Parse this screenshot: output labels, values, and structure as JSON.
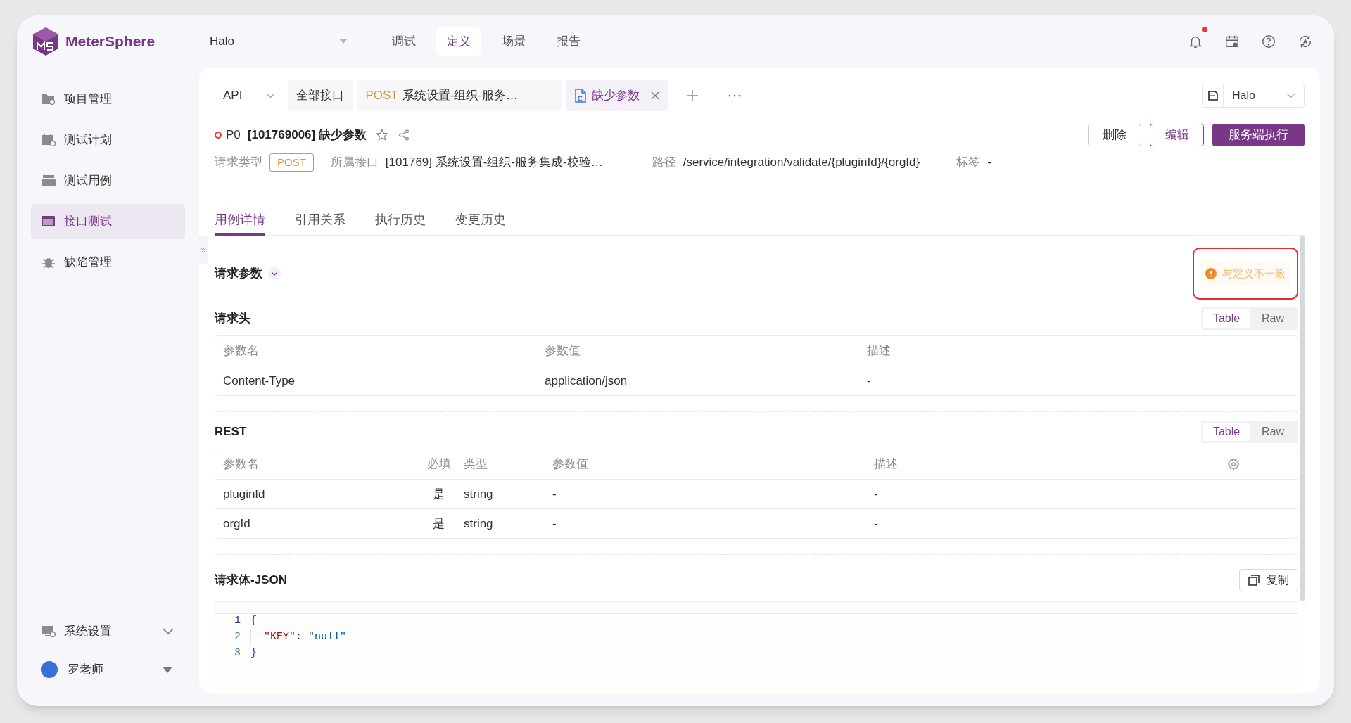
{
  "app": {
    "logo_text": "MeterSphere",
    "project": "Halo"
  },
  "top_nav": [
    {
      "label": "调试",
      "selected": false
    },
    {
      "label": "定义",
      "selected": true
    },
    {
      "label": "场景",
      "selected": false
    },
    {
      "label": "报告",
      "selected": false
    }
  ],
  "notifications": {
    "unread": true
  },
  "sidebar": {
    "items": [
      {
        "label": "项目管理",
        "kind": "folder",
        "selected": false
      },
      {
        "label": "测试计划",
        "kind": "plan",
        "selected": false
      },
      {
        "label": "测试用例",
        "kind": "case",
        "selected": false
      },
      {
        "label": "接口测试",
        "kind": "api",
        "selected": true
      },
      {
        "label": "缺陷管理",
        "kind": "bug",
        "selected": false
      }
    ],
    "settings": {
      "label": "系统设置"
    },
    "user": {
      "name": "罗老师"
    }
  },
  "tab_strip": {
    "module": "API",
    "tabs": [
      {
        "kind": "plain",
        "label": "全部接口",
        "selected": false
      },
      {
        "kind": "api",
        "method": "POST",
        "label": "系统设置-组织-服务…",
        "selected": false
      },
      {
        "kind": "case",
        "label": "缺少参数",
        "selected": true
      }
    ],
    "environment": "Halo"
  },
  "case": {
    "priority": "P0",
    "title": "[101769006] 缺少参数"
  },
  "actions": [
    {
      "label": "删除",
      "kind": "default"
    },
    {
      "label": "编辑",
      "kind": "outline"
    },
    {
      "label": "服务端执行",
      "kind": "primary"
    }
  ],
  "info": [
    {
      "label": "请求类型",
      "value": "POST",
      "kind": "badge"
    },
    {
      "label": "所属接口",
      "value": "[101769] 系统设置-组织-服务集成-校验…",
      "kind": "text"
    },
    {
      "label": "路径",
      "value": "/service/integration/validate/{pluginId}/{orgId}",
      "kind": "text"
    },
    {
      "label": "标签",
      "value": "-",
      "kind": "text"
    }
  ],
  "detail_tabs": [
    {
      "label": "用例详情",
      "selected": true
    },
    {
      "label": "引用关系",
      "selected": false
    },
    {
      "label": "执行历史",
      "selected": false
    },
    {
      "label": "变更历史",
      "selected": false
    }
  ],
  "request_params": {
    "title": "请求参数",
    "warning": "与定义不一致"
  },
  "headers": {
    "title": "请求头",
    "view_toggle": [
      {
        "label": "Table",
        "selected": true
      },
      {
        "label": "Raw",
        "selected": false
      }
    ],
    "columns": [
      "参数名",
      "参数值",
      "描述"
    ],
    "rows": [
      [
        "Content-Type",
        "application/json",
        "-"
      ]
    ]
  },
  "rest": {
    "title": "REST",
    "view_toggle": [
      {
        "label": "Table",
        "selected": true
      },
      {
        "label": "Raw",
        "selected": false
      }
    ],
    "columns": [
      "参数名",
      "必填",
      "类型",
      "参数值",
      "描述"
    ],
    "rows": [
      [
        "pluginId",
        "是",
        "string",
        "-",
        "-"
      ],
      [
        "orgId",
        "是",
        "string",
        "-",
        "-"
      ]
    ]
  },
  "body": {
    "title": "请求体-JSON",
    "copy_button": "复制",
    "lines": [
      {
        "number": "1",
        "indent": false,
        "tokens": [
          {
            "text": "{",
            "kind": "brace"
          }
        ]
      },
      {
        "number": "2",
        "indent": true,
        "tokens": [
          {
            "text": "\"KEY\"",
            "kind": "key"
          },
          {
            "text": ": ",
            "kind": "punct"
          },
          {
            "text": "\"null\"",
            "kind": "string"
          }
        ]
      },
      {
        "number": "3",
        "indent": false,
        "tokens": [
          {
            "text": "}",
            "kind": "brace"
          }
        ]
      }
    ]
  }
}
